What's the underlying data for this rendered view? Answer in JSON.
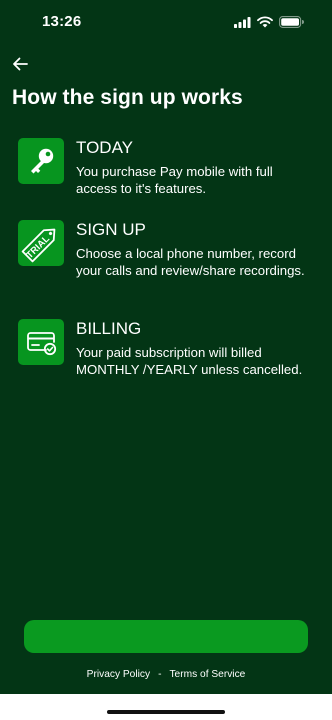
{
  "status_bar": {
    "time": "13:26"
  },
  "page": {
    "title": "How the sign up works"
  },
  "steps": [
    {
      "title": "TODAY",
      "description": "You purchase Pay mobile with full access to it's features.",
      "icon": "key-icon"
    },
    {
      "title": "SIGN UP",
      "description": "Choose a local phone number, record your calls and review/share recordings.",
      "icon": "trial-tag-icon",
      "icon_text": "TRIAL"
    },
    {
      "title": "BILLING",
      "description": "Your paid subscription will billed MONTHLY /YEARLY unless cancelled.",
      "icon": "credit-card-check-icon"
    }
  ],
  "cta": {
    "label": ""
  },
  "footer": {
    "privacy_label": "Privacy Policy",
    "separator": "-",
    "terms_label": "Terms of Service"
  },
  "colors": {
    "background": "#033515",
    "accent": "#07951f",
    "button": "#0a9a20",
    "text": "#ffffff"
  }
}
